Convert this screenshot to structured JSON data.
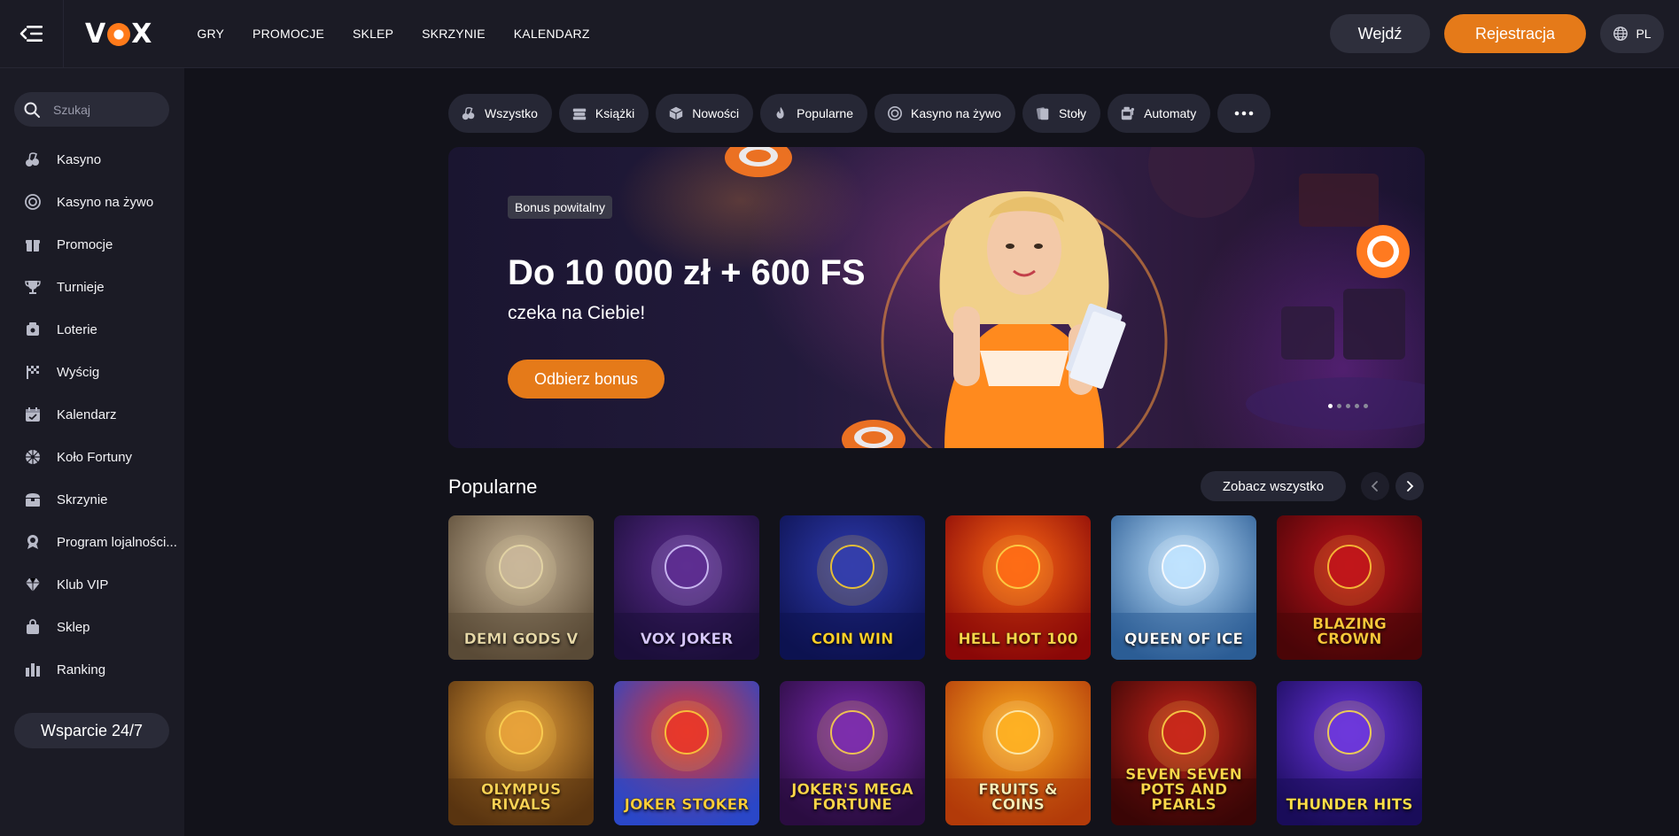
{
  "header": {
    "logo": "VOX",
    "nav": [
      "GRY",
      "PROMOCJE",
      "SKLEP",
      "SKRZYNIE",
      "KALENDARZ"
    ],
    "login_label": "Wejdź",
    "register_label": "Rejestracja",
    "lang": "PL"
  },
  "sidebar": {
    "search_placeholder": "Szukaj",
    "items": [
      {
        "label": "Kasyno",
        "icon": "cherries-icon"
      },
      {
        "label": "Kasyno na żywo",
        "icon": "live-chip-icon"
      },
      {
        "label": "Promocje",
        "icon": "gift-icon"
      },
      {
        "label": "Turnieje",
        "icon": "trophy-icon"
      },
      {
        "label": "Loterie",
        "icon": "lottery-icon"
      },
      {
        "label": "Wyścig",
        "icon": "race-flag-icon"
      },
      {
        "label": "Kalendarz",
        "icon": "calendar-icon"
      },
      {
        "label": "Koło Fortuny",
        "icon": "wheel-icon"
      },
      {
        "label": "Skrzynie",
        "icon": "chest-icon"
      },
      {
        "label": "Program lojalności...",
        "icon": "badge-icon"
      },
      {
        "label": "Klub VIP",
        "icon": "diamond-icon"
      },
      {
        "label": "Sklep",
        "icon": "shop-bag-icon"
      },
      {
        "label": "Ranking",
        "icon": "ranking-icon"
      }
    ],
    "support_label": "Wsparcie 24/7"
  },
  "categories": [
    {
      "label": "Wszystko",
      "icon": "cherries-icon"
    },
    {
      "label": "Książki",
      "icon": "books-icon"
    },
    {
      "label": "Nowości",
      "icon": "cube-icon"
    },
    {
      "label": "Popularne",
      "icon": "flame-icon"
    },
    {
      "label": "Kasyno na żywo",
      "icon": "live-chip-icon"
    },
    {
      "label": "Stoły",
      "icon": "cards-icon"
    },
    {
      "label": "Automaty",
      "icon": "slot-machine-icon"
    }
  ],
  "hero": {
    "badge": "Bonus powitalny",
    "title": "Do 10 000 zł + 600 FS",
    "subtitle": "czeka na Ciebie!",
    "cta": "Odbierz bonus",
    "slides": 5,
    "active_slide": 1
  },
  "popular": {
    "title": "Popularne",
    "see_all": "Zobacz wszystko",
    "games": [
      {
        "name": "Demi Gods V",
        "colors": [
          "#c9b79a",
          "#5a4a36"
        ],
        "text": "#e8d9a8"
      },
      {
        "name": "Vox Joker",
        "colors": [
          "#5b2a8f",
          "#1c0f3a"
        ],
        "text": "#d8c8ff"
      },
      {
        "name": "Coin Win",
        "colors": [
          "#2f3bb0",
          "#0d1250"
        ],
        "text": "#ffd22a"
      },
      {
        "name": "Hell Hot 100",
        "colors": [
          "#ff6a14",
          "#8a0808"
        ],
        "text": "#ffd84a"
      },
      {
        "name": "Queen of Ice",
        "colors": [
          "#bfe3ff",
          "#2c5d95"
        ],
        "text": "#ffffff"
      },
      {
        "name": "Blazing Crown",
        "colors": [
          "#c0121a",
          "#4a0508"
        ],
        "text": "#ffc93a"
      },
      {
        "name": "Olympus Rivals",
        "colors": [
          "#e8a23a",
          "#5a3410"
        ],
        "text": "#ffd455"
      },
      {
        "name": "Joker Stoker",
        "colors": [
          "#e8342a",
          "#2a47c8"
        ],
        "text": "#ffcf3a"
      },
      {
        "name": "Joker's Mega Fortune",
        "colors": [
          "#7a2ab0",
          "#2a0c40"
        ],
        "text": "#ffd64a"
      },
      {
        "name": "Fruits & Coins",
        "colors": [
          "#ffb020",
          "#b23a0a"
        ],
        "text": "#fff0b8"
      },
      {
        "name": "Seven Seven Pots and Pearls",
        "colors": [
          "#c8241a",
          "#3a0606"
        ],
        "text": "#ffd84a"
      },
      {
        "name": "Thunder Hits",
        "colors": [
          "#6a34e0",
          "#1a0c5a"
        ],
        "text": "#ffe04a"
      }
    ]
  }
}
